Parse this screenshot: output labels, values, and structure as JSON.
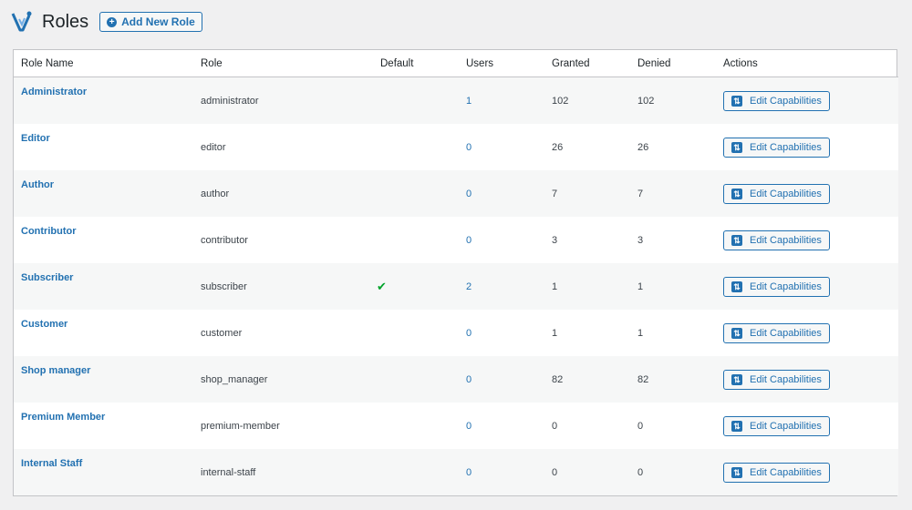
{
  "header": {
    "title": "Roles",
    "add_button_label": "Add New Role",
    "logo_icon": "capability-manager-logo-icon",
    "brand_color": "#2271b1"
  },
  "table": {
    "columns": [
      "Role Name",
      "Role",
      "Default",
      "Users",
      "Granted",
      "Denied",
      "Actions"
    ],
    "action_label": "Edit Capabilities",
    "rows": [
      {
        "name": "Administrator",
        "slug": "administrator",
        "default": "",
        "users": "1",
        "granted": "102",
        "denied": "102"
      },
      {
        "name": "Editor",
        "slug": "editor",
        "default": "",
        "users": "0",
        "granted": "26",
        "denied": "26"
      },
      {
        "name": "Author",
        "slug": "author",
        "default": "",
        "users": "0",
        "granted": "7",
        "denied": "7"
      },
      {
        "name": "Contributor",
        "slug": "contributor",
        "default": "",
        "users": "0",
        "granted": "3",
        "denied": "3"
      },
      {
        "name": "Subscriber",
        "slug": "subscriber",
        "default": "✔",
        "users": "2",
        "granted": "1",
        "denied": "1"
      },
      {
        "name": "Customer",
        "slug": "customer",
        "default": "",
        "users": "0",
        "granted": "1",
        "denied": "1"
      },
      {
        "name": "Shop manager",
        "slug": "shop_manager",
        "default": "",
        "users": "0",
        "granted": "82",
        "denied": "82"
      },
      {
        "name": "Premium Member",
        "slug": "premium-member",
        "default": "",
        "users": "0",
        "granted": "0",
        "denied": "0"
      },
      {
        "name": "Internal Staff",
        "slug": "internal-staff",
        "default": "",
        "users": "0",
        "granted": "0",
        "denied": "0"
      }
    ]
  }
}
